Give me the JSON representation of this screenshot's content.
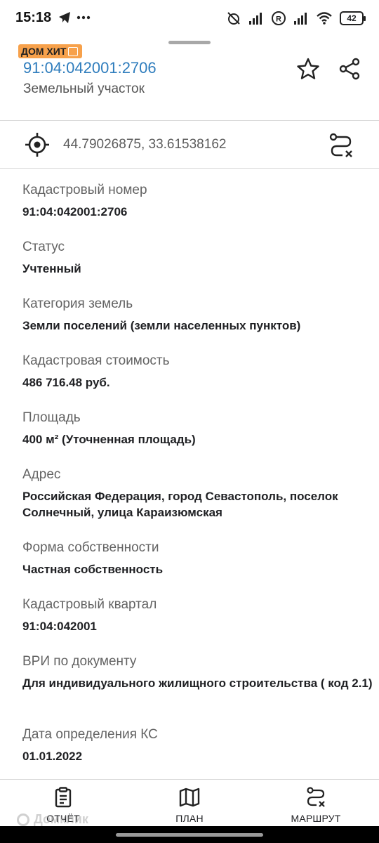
{
  "status_bar": {
    "time": "15:18",
    "battery": "42",
    "left_icons": [
      "telegram-icon",
      "more-dots-icon"
    ],
    "right_icons": [
      "alarm-off-icon",
      "signal-icon",
      "roaming-icon",
      "signal-icon",
      "wifi-icon",
      "battery-icon"
    ]
  },
  "header": {
    "badge": "ДОМ ХИТ",
    "cadastral_number": "91:04:042001:2706",
    "object_type": "Земельный участок",
    "actions": [
      "star-icon",
      "share-icon"
    ]
  },
  "location": {
    "coordinates": "44.79026875, 33.61538162"
  },
  "properties": [
    {
      "label": "Кадастровый номер",
      "value": "91:04:042001:2706"
    },
    {
      "label": "Статус",
      "value": "Учтенный"
    },
    {
      "label": "Категория земель",
      "value": "Земли поселений (земли населенных пунктов)"
    },
    {
      "label": "Кадастровая стоимость",
      "value": "486 716.48 руб."
    },
    {
      "label": "Площадь",
      "value": "400 м² (Уточненная площадь)"
    },
    {
      "label": "Адрес",
      "value": "Российская Федерация, город Севастополь, поселок Солнечный, улица Караизюмская"
    },
    {
      "label": "Форма собственности",
      "value": "Частная собственность"
    },
    {
      "label": "Кадастровый квартал",
      "value": "91:04:042001"
    },
    {
      "label": "ВРИ по документу",
      "value": "Для индивидуального жилищного строительства ( код 2.1)"
    },
    {
      "label": "Дата определения КС",
      "value": "01.01.2022"
    }
  ],
  "bottom_nav": {
    "report": "ОТЧЁТ",
    "plan": "ПЛАН",
    "route": "МАРШРУТ"
  },
  "watermark": "Домклик",
  "colors": {
    "link": "#2f7dbd",
    "badge": "#f7a14b",
    "text": "#202124",
    "label": "#636363"
  }
}
